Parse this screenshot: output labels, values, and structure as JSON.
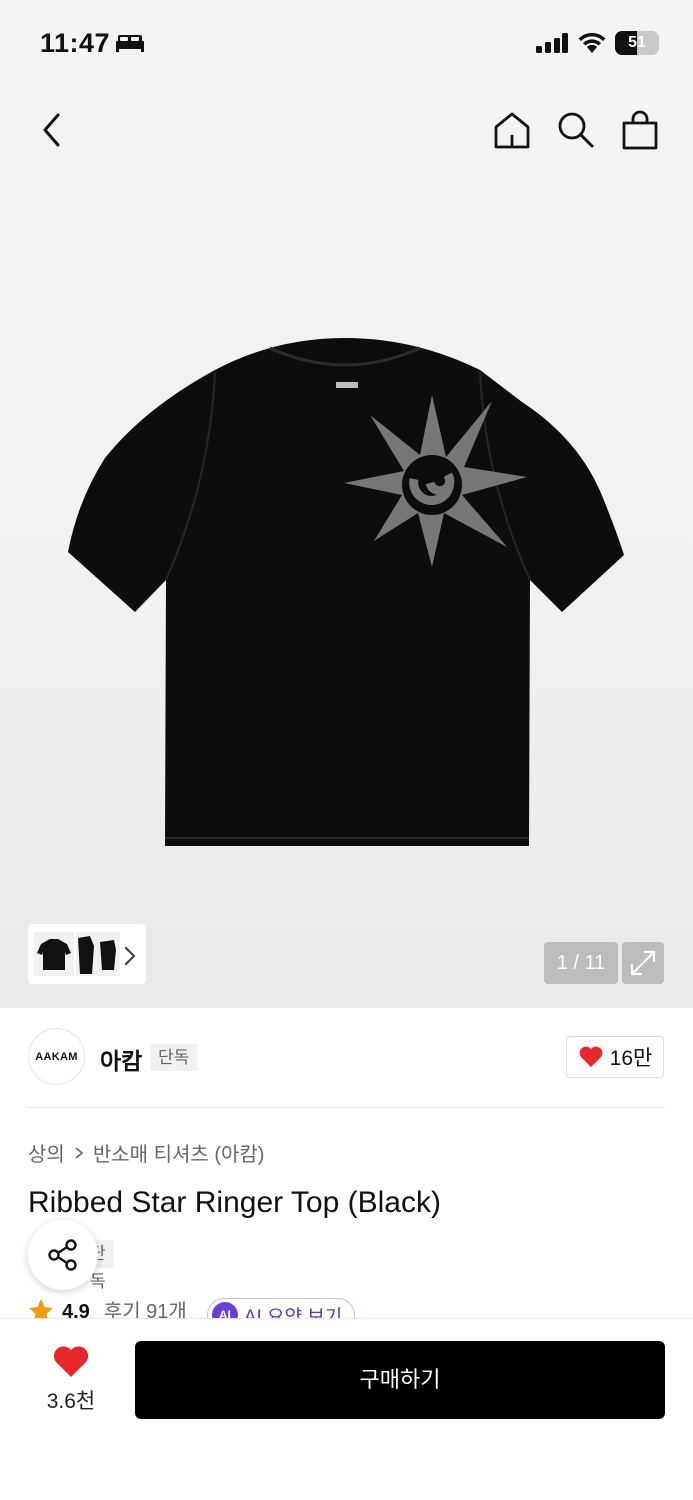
{
  "status_bar": {
    "time": "11:47",
    "battery_level": "51",
    "battery_fraction": 0.51,
    "icons": [
      "bed-icon",
      "signal-icon",
      "wifi-icon",
      "battery-icon"
    ]
  },
  "nav": {
    "icons": [
      "back-icon",
      "home-icon",
      "search-icon",
      "shopping-bag-icon"
    ]
  },
  "gallery": {
    "image_subject": "black t-shirt with grey star graphic",
    "thumbnail_chevron_icon": "chevron-right-icon",
    "page_counter": "1 / 11",
    "expand_icon": "expand-icon"
  },
  "brand": {
    "logo_text": "AAKAM",
    "name": "아캄",
    "badge": "단독",
    "like_count": "16만",
    "like_icon": "heart-icon"
  },
  "breadcrumb": {
    "category": "상의",
    "subcategory": "반소매 티셔츠 (아캄)"
  },
  "product": {
    "title": "Ribbed Star Ringer Top (Black)",
    "tag": "단독",
    "rating": "4.9",
    "reviews": "후기 91개",
    "ai_badge": "AI",
    "ai_summary_label": "AI 요약 보기"
  },
  "bottom_bar": {
    "wish_count": "3.6천",
    "buy_label": "구매하기"
  },
  "colors": {
    "heart": "#e8262b",
    "star": "#f29b0c",
    "ai_accent": "#6a3fd8",
    "buy_button": "#000000"
  }
}
